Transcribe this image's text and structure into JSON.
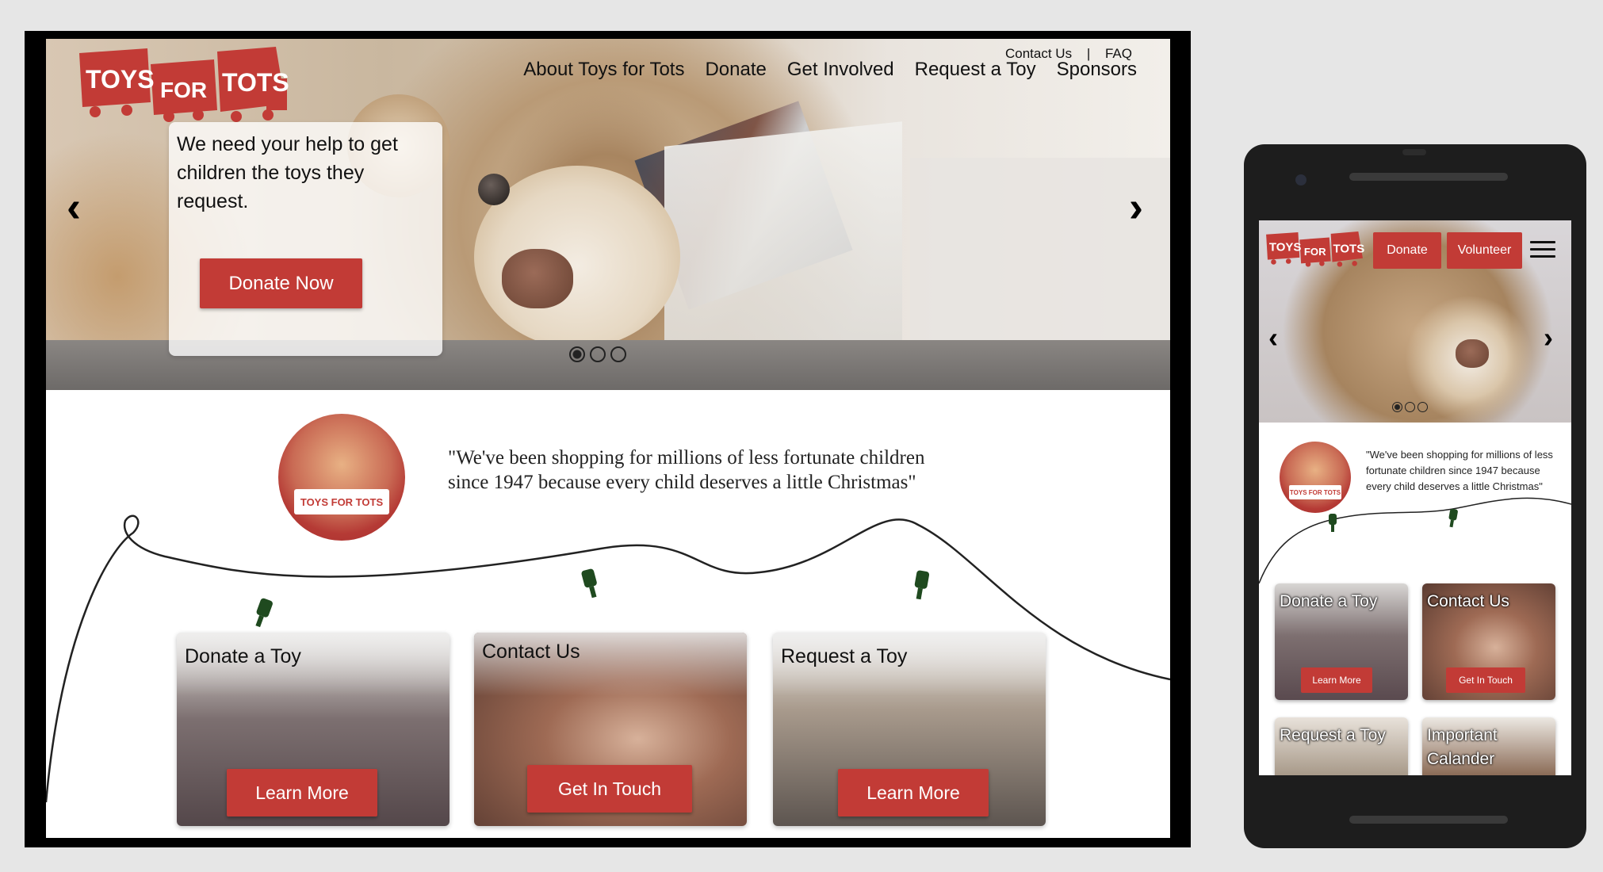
{
  "brand": {
    "logo_words": [
      "TOYS",
      "FOR",
      "TOTS"
    ],
    "accent_color": "#c23b36",
    "bulb_color": "#1f4a1f"
  },
  "desktop": {
    "utility_links": [
      "Contact Us",
      "FAQ"
    ],
    "nav": [
      "About Toys for Tots",
      "Donate",
      "Get Involved",
      "Request a Toy",
      "Sponsors"
    ],
    "hero": {
      "message": "We need your help to get children the toys they request.",
      "cta": "Donate Now",
      "prev_icon": "‹",
      "next_icon": "›",
      "slides_total": 3,
      "active_slide": 1
    },
    "quote": "\"We've been shopping for millions of less fortunate children since 1947 because every child deserves a little Christmas\"",
    "cards": [
      {
        "title": "Donate a Toy",
        "button": "Learn More"
      },
      {
        "title": "Contact Us",
        "button": "Get In Touch"
      },
      {
        "title": "Request a Toy",
        "button": "Learn More"
      }
    ]
  },
  "mobile": {
    "buttons": {
      "donate": "Donate",
      "volunteer": "Volunteer"
    },
    "menu_icon": "hamburger-icon",
    "quote": "\"We've been shopping for millions of less fortunate children since 1947 because every child deserves a little Christmas\"",
    "cards": [
      {
        "title": "Donate a Toy",
        "button": "Learn More"
      },
      {
        "title": "Contact Us",
        "button": "Get In Touch"
      },
      {
        "title": "Request a Toy",
        "button": ""
      },
      {
        "title": "Important Calander",
        "button": ""
      }
    ]
  }
}
